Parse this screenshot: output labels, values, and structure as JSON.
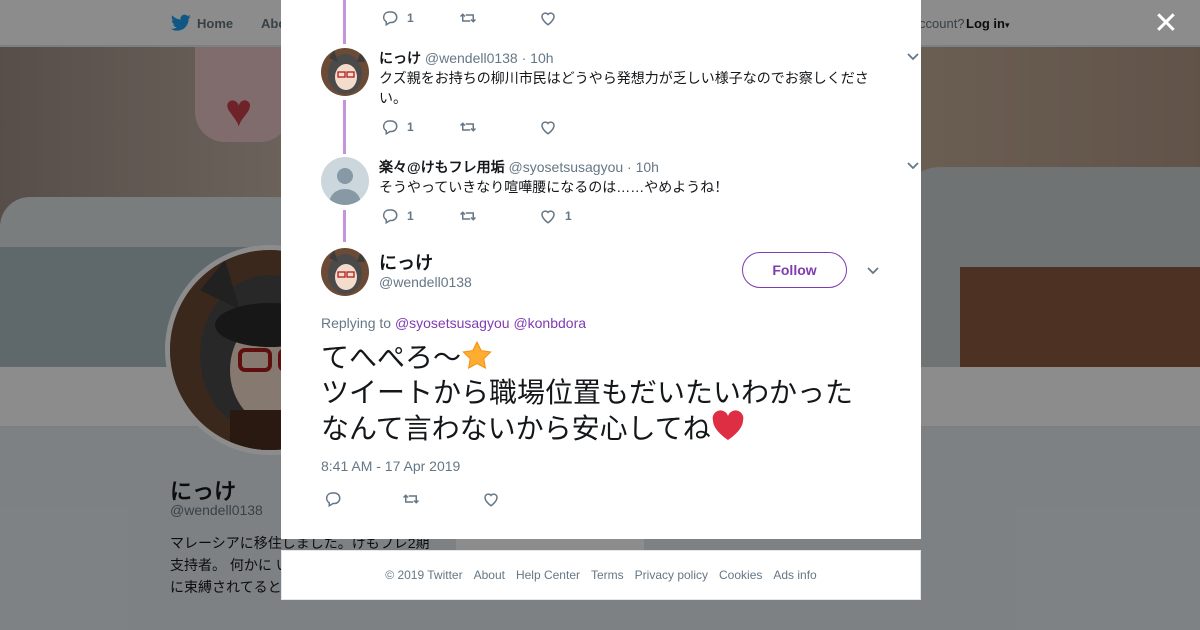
{
  "nav": {
    "home": "Home",
    "about": "Abo",
    "have_account": "ccount?",
    "login": "Log in"
  },
  "profile": {
    "name": "にっけ",
    "handle": "@wendell0138",
    "bio": "マレーシアに移住しました。けもフレ2期支持者。 何かに いことを素直に楽 わり」に束縛されてると思わない？"
  },
  "side_card": {
    "text": "Ads info"
  },
  "replies": [
    {
      "name": "にっけ",
      "handle": "@wendell0138",
      "time": "· 10h",
      "text": "クズ親をお持ちの柳川市民はどうやら発想力が乏しい様子なのでお察しください。",
      "reply_count": "1",
      "like_count": ""
    },
    {
      "name": "楽々@けもフレ用垢",
      "handle": "@syosetsusagyou",
      "time": "· 10h",
      "text": "そうやっていきなり喧嘩腰になるのは……やめようね！",
      "reply_count": "1",
      "like_count": "1"
    }
  ],
  "top_actions": {
    "reply_count": "1"
  },
  "main_tweet": {
    "name": "にっけ",
    "handle": "@wendell0138",
    "follow_label": "Follow",
    "replying_prefix": "Replying to ",
    "mention_1": "@syosetsusagyou",
    "mention_2": "@konbdora",
    "line_1": "てへぺろ〜",
    "line_2": "ツイートから職場位置もだいたいわかった",
    "line_3": "なんて言わないから安心してね",
    "timestamp": "8:41 AM - 17 Apr 2019"
  },
  "footer": {
    "copyright": "© 2019 Twitter",
    "about": "About",
    "help": "Help Center",
    "terms": "Terms",
    "privacy": "Privacy policy",
    "cookies": "Cookies",
    "ads": "Ads info"
  },
  "colors": {
    "accent": "#7f3bb0",
    "thread_line": "#c694dd",
    "text_primary": "#14171a",
    "text_secondary": "#657786",
    "twitter_blue": "#1da1f2"
  },
  "icons": [
    "twitter-bird-icon",
    "close-icon",
    "reply-icon",
    "retweet-icon",
    "like-icon",
    "chevron-down-icon",
    "star-emoji-icon",
    "heart-emoji-icon"
  ]
}
